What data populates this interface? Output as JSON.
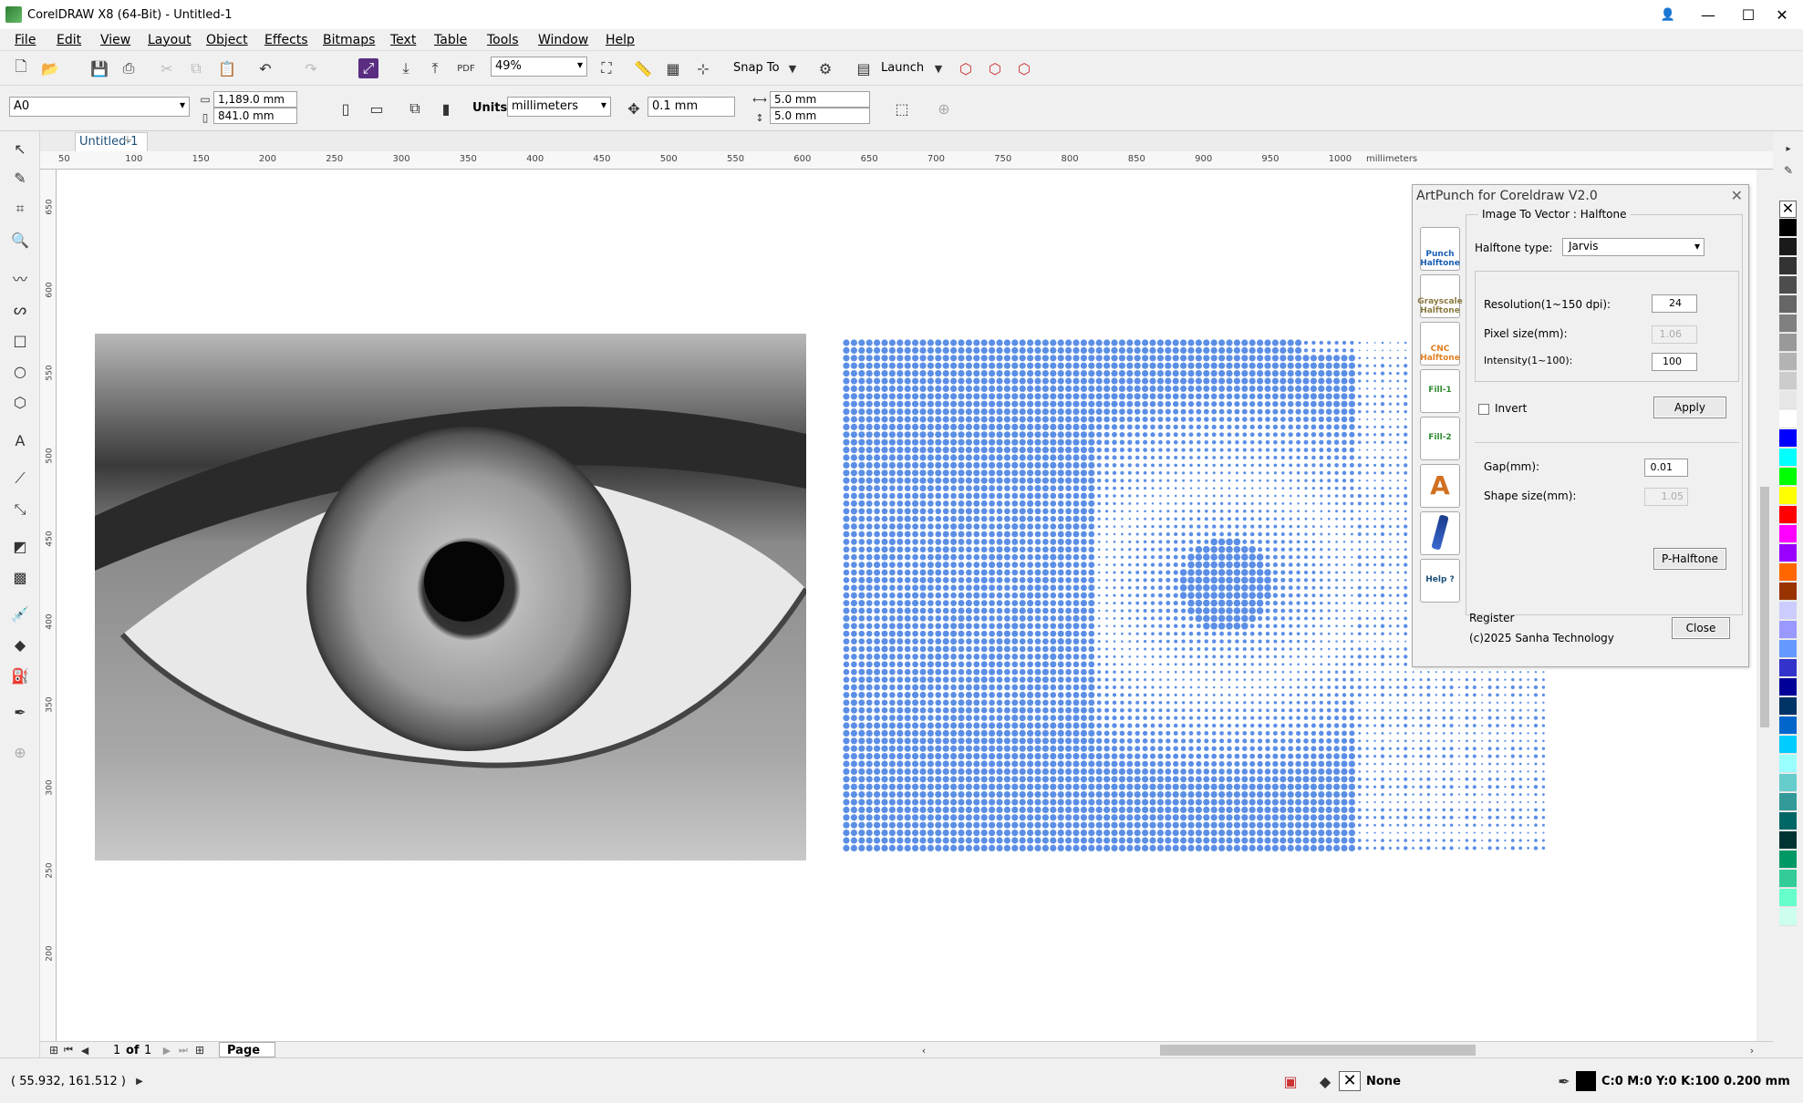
{
  "window": {
    "title": "CorelDRAW X8 (64-Bit) - Untitled-1"
  },
  "menu": [
    "File",
    "Edit",
    "View",
    "Layout",
    "Object",
    "Effects",
    "Bitmaps",
    "Text",
    "Table",
    "Tools",
    "Window",
    "Help"
  ],
  "toolbar": {
    "zoom": "49%",
    "snap_to": "Snap To",
    "launch": "Launch"
  },
  "property_bar": {
    "page_size": "A0",
    "width": "1,189.0 mm",
    "height": "841.0 mm",
    "units_label": "Units:",
    "units": "millimeters",
    "nudge": "0.1 mm",
    "dup_x": "5.0 mm",
    "dup_y": "5.0 mm"
  },
  "document_tab": "Untitled-1",
  "ruler_h": [
    "50",
    "100",
    "150",
    "200",
    "250",
    "300",
    "350",
    "400",
    "450",
    "500",
    "550",
    "600",
    "650",
    "700",
    "750",
    "800",
    "850",
    "900",
    "950",
    "1000",
    "millimeters"
  ],
  "ruler_v": [
    "650",
    "600",
    "550",
    "500",
    "450",
    "400",
    "350",
    "300",
    "250",
    "200"
  ],
  "dialog": {
    "title": "ArtPunch for Coreldraw V2.0",
    "group_label": "Image To Vector : Halftone",
    "halftone_type_label": "Halftone type:",
    "halftone_type": "Jarvis",
    "resolution_label": "Resolution(1~150 dpi):",
    "resolution": "24",
    "pixel_size_label": "Pixel size(mm):",
    "pixel_size": "1.06",
    "intensity_label": "Intensity(1~100):",
    "intensity": "100",
    "invert_label": "Invert",
    "apply": "Apply",
    "gap_label": "Gap(mm):",
    "gap": "0.01",
    "shape_size_label": "Shape size(mm):",
    "shape_size": "1.05",
    "p_halftone": "P-Halftone",
    "register": "Register",
    "copyright": "(c)2025 Sanha Technology",
    "close": "Close",
    "side_buttons": [
      "Punch Halftone",
      "Grayscale Halftone",
      "CNC Halftone",
      "Fill-1",
      "Fill-2",
      "A",
      "",
      "Help ?"
    ]
  },
  "pager": {
    "current": "1",
    "of": "of",
    "total": "1",
    "page_tab": "Page 1"
  },
  "status": {
    "coords": "( 55.932, 161.512 )",
    "fill": "None",
    "outline": "C:0 M:0 Y:0 K:100  0.200 mm"
  },
  "colors": {
    "accent": "#0078d7",
    "halftone_dot": "#5b8ee6",
    "palette": [
      "#000000",
      "#1a1a1a",
      "#333333",
      "#4d4d4d",
      "#666666",
      "#808080",
      "#999999",
      "#b3b3b3",
      "#cccccc",
      "#e6e6e6",
      "#ffffff",
      "#0000ff",
      "#00ffff",
      "#00ff00",
      "#ffff00",
      "#ff0000",
      "#ff00ff",
      "#9900ff",
      "#ff6600",
      "#993300",
      "#ccccff",
      "#9999ff",
      "#6699ff",
      "#3333cc",
      "#000099",
      "#003366",
      "#0066cc",
      "#00ccff",
      "#99ffff",
      "#66cccc",
      "#339999",
      "#006666",
      "#003333",
      "#009966",
      "#33cc99",
      "#66ffcc",
      "#ccffee"
    ]
  }
}
